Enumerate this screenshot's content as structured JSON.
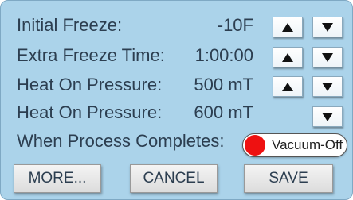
{
  "rows": [
    {
      "label": "Initial Freeze:",
      "value": "-10F"
    },
    {
      "label": "Extra Freeze Time:",
      "value": "1:00:00"
    },
    {
      "label": "Heat On Pressure:",
      "value": "500 mT"
    },
    {
      "label": "Heat On Pressure:",
      "value": "600 mT"
    }
  ],
  "completion": {
    "label": "When Process Completes:",
    "toggle_text": "Vacuum-Off",
    "indicator_color": "#ee1111"
  },
  "buttons": {
    "more": "MORE...",
    "cancel": "CANCEL",
    "save": "SAVE"
  },
  "icons": {
    "increase": "up-arrow-icon",
    "decrease": "down-arrow-icon"
  },
  "colors": {
    "panel_bg": "#abd3ea",
    "text": "#2c3e50"
  }
}
